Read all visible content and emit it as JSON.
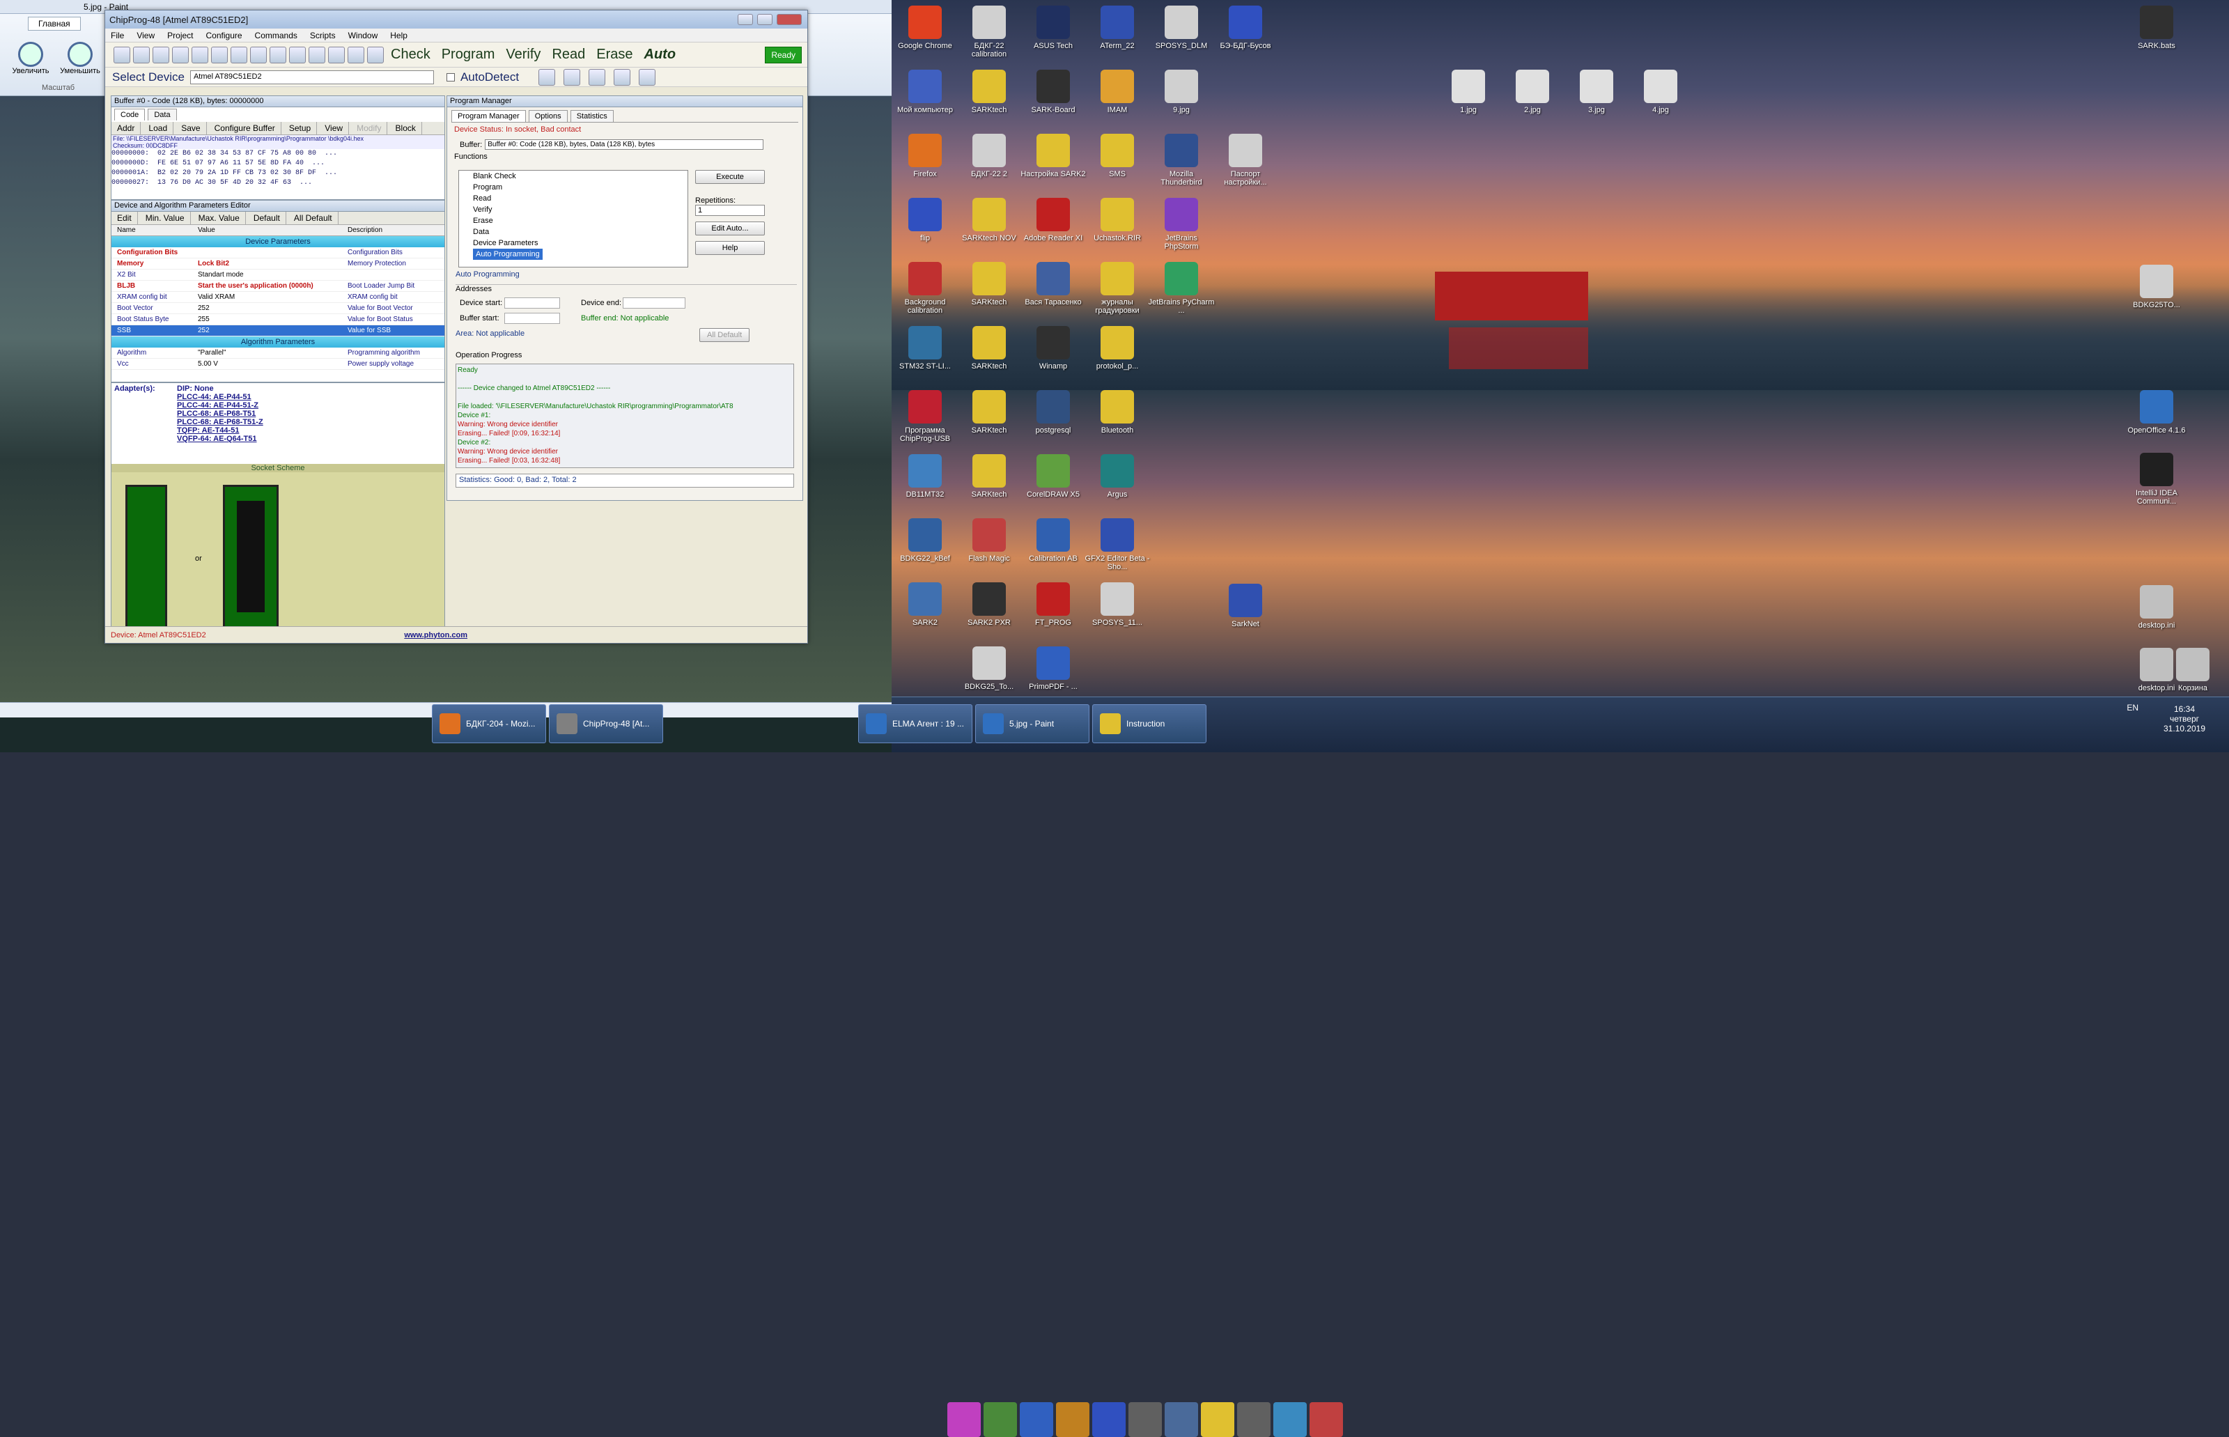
{
  "paint": {
    "title": "5.jpg - Paint",
    "tab_home": "Главная",
    "zoom_in": "Увеличить",
    "zoom_out": "Уменьшить",
    "group": "Масштаб"
  },
  "chipprog": {
    "title": "ChipProg-48 [Atmel AT89C51ED2]",
    "menu": [
      "File",
      "View",
      "Project",
      "Configure",
      "Commands",
      "Scripts",
      "Window",
      "Help"
    ],
    "commands": [
      "Check",
      "Program",
      "Verify",
      "Read",
      "Erase",
      "Auto"
    ],
    "ready": "Ready",
    "select_device": "Select Device",
    "device_combo": "Atmel AT89C51ED2",
    "autodetect": "AutoDetect",
    "buffer": {
      "title": "Buffer #0 - Code (128 KB), bytes: 00000000",
      "tabs": [
        "Code",
        "Data"
      ],
      "toolbar": [
        "Addr",
        "Load",
        "Save",
        "Configure Buffer",
        "Setup",
        "View",
        "Modify",
        "Block"
      ],
      "file": "File: \\\\FILESERVER\\Manufacture\\Uchastok RIR\\programming\\Programmator \\bdkg04i.hex",
      "checksum": "Checksum: 00DC8DFF",
      "rows": [
        "00000000:  02 2E B6 02 38 34 53 87 CF 75 A8 00 80  ...",
        "0000000D:  FE 6E 51 07 97 A6 11 57 5E 8D FA 40  ...",
        "0000001A:  B2 02 20 79 2A 1D FF CB 73 02 30 8F DF  ...",
        "00000027:  13 76 D0 AC 30 5F 4D 20 32 4F 63  ..."
      ]
    },
    "params": {
      "title": "Device and Algorithm Parameters Editor",
      "toolbar": [
        "Edit",
        "Min. Value",
        "Max. Value",
        "Default",
        "All Default"
      ],
      "headers": [
        "Name",
        "Value",
        "Description"
      ],
      "section1": "Device Parameters",
      "rows": [
        {
          "name": "Configuration Bits",
          "value": "",
          "desc": "Configuration Bits",
          "red": true
        },
        {
          "name": "Memory",
          "value": "Lock Bit2",
          "desc": "Memory Protection",
          "red": true
        },
        {
          "name": "X2 Bit",
          "value": "Standart mode",
          "desc": ""
        },
        {
          "name": "BLJB",
          "value": "Start the user's application (0000h)",
          "desc": "Boot Loader Jump Bit",
          "red": true
        },
        {
          "name": "XRAM config bit",
          "value": "Valid XRAM",
          "desc": "XRAM config bit"
        },
        {
          "name": "Boot Vector",
          "value": "252",
          "desc": "Value for Boot Vector"
        },
        {
          "name": "Boot Status Byte",
          "value": "255",
          "desc": "Value for Boot Status"
        },
        {
          "name": "SSB",
          "value": "252",
          "desc": "Value for SSB",
          "selected": true
        }
      ],
      "section2": "Algorithm Parameters",
      "rows2": [
        {
          "name": "Algorithm",
          "value": "\"Parallel\"",
          "desc": "Programming algorithm"
        },
        {
          "name": "Vcc",
          "value": "5.00 V",
          "desc": "Power supply voltage"
        }
      ]
    },
    "adapters": {
      "label": "Adapter(s):",
      "items": [
        "DIP: None",
        "PLCC-44: AE-P44-51",
        "PLCC-44: AE-P44-51-Z",
        "PLCC-68: AE-P68-T51",
        "PLCC-68: AE-P68-T51-Z",
        "TQFP: AE-T44-51",
        "VQFP-64: AE-Q64-T51"
      ],
      "scheme": "Socket Scheme",
      "or": "or"
    },
    "status": "Device: Atmel AT89C51ED2",
    "website": "www.phyton.com",
    "pm": {
      "title": "Program Manager",
      "tabs": [
        "Program Manager",
        "Options",
        "Statistics"
      ],
      "device_status": "Device Status: In socket, Bad contact",
      "buffer_label": "Buffer:",
      "buffer_value": "Buffer #0: Code (128 KB), bytes, Data (128 KB), bytes",
      "functions_label": "Functions",
      "functions": [
        "Blank Check",
        "Program",
        "Read",
        "Verify",
        "Erase",
        "Data",
        "Device Parameters",
        "Auto Programming"
      ],
      "execute": "Execute",
      "repetitions_label": "Repetitions:",
      "repetitions": "1",
      "edit_auto": "Edit Auto...",
      "help": "Help",
      "auto_programming": "Auto Programming",
      "addresses": "Addresses",
      "device_start": "Device start:",
      "device_end": "Device end:",
      "buffer_start": "Buffer start:",
      "buffer_end": "Buffer end:  Not applicable",
      "area": "Area:  Not applicable",
      "all_default": "All Default",
      "op_progress": "Operation Progress",
      "log": [
        {
          "t": "Ready",
          "c": "#0a7a0a"
        },
        {
          "t": "",
          "c": "#000"
        },
        {
          "t": "------ Device changed to Atmel AT89C51ED2 ------",
          "c": "#0a7a0a"
        },
        {
          "t": "",
          "c": "#000"
        },
        {
          "t": "File loaded: '\\\\FILESERVER\\Manufacture\\Uchastok RIR\\programming\\Programmator\\AT8",
          "c": "#0a7a0a"
        },
        {
          "t": "Device #1:",
          "c": "#0a7a0a"
        },
        {
          "t": "Warning: Wrong device identifier",
          "c": "#c01010"
        },
        {
          "t": "Erasing... Failed! [0:09,  16:32:14]",
          "c": "#c01010"
        },
        {
          "t": "Device #2:",
          "c": "#0a7a0a"
        },
        {
          "t": "Warning: Wrong device identifier",
          "c": "#c01010"
        },
        {
          "t": "Erasing... Failed! [0:03,  16:32:48]",
          "c": "#c01010"
        }
      ],
      "stats": "Statistics:  Good: 0,  Bad: 2,  Total: 2"
    }
  },
  "desktop": {
    "icons_col": [
      {
        "label": "Google Chrome",
        "color": "#e04020"
      },
      {
        "label": "Мой компьютер",
        "color": "#4060c0"
      },
      {
        "label": "Firefox",
        "color": "#e07020"
      },
      {
        "label": "flip",
        "color": "#3050c0"
      },
      {
        "label": "Background calibration",
        "color": "#c03030"
      },
      {
        "label": "STM32 ST-LI...",
        "color": "#3070a0"
      },
      {
        "label": "Программа ChipProg-USB",
        "color": "#c02030"
      },
      {
        "label": "DB11MT32",
        "color": "#4080c0"
      },
      {
        "label": "BDKG22_kBef",
        "color": "#3060a0"
      },
      {
        "label": "SARK2",
        "color": "#4070b0"
      }
    ],
    "icons_col2": [
      {
        "label": "БДКГ-22 calibration",
        "color": "#d0d0d0"
      },
      {
        "label": "SARKtech",
        "color": "#e0c030"
      },
      {
        "label": "БДКГ-22 2",
        "color": "#d0d0d0"
      },
      {
        "label": "SARKtech NOV",
        "color": "#e0c030"
      },
      {
        "label": "SARKtech",
        "color": "#e0c030"
      },
      {
        "label": "SARKtech",
        "color": "#e0c030"
      },
      {
        "label": "SARKtech",
        "color": "#e0c030"
      },
      {
        "label": "SARKtech",
        "color": "#e0c030"
      },
      {
        "label": "Flash Magic",
        "color": "#c04040"
      },
      {
        "label": "SARK2 PXR",
        "color": "#303030"
      },
      {
        "label": "BDKG25_To...",
        "color": "#d0d0d0"
      }
    ],
    "icons_col3": [
      {
        "label": "ASUS Tech",
        "color": "#203060"
      },
      {
        "label": "SARK-Board",
        "color": "#303030"
      },
      {
        "label": "Настройка SARK2",
        "color": "#e0c030"
      },
      {
        "label": "Adobe Reader XI",
        "color": "#c02020"
      },
      {
        "label": "Вася Тарасенко",
        "color": "#4060a0"
      },
      {
        "label": "Winamp",
        "color": "#303030"
      },
      {
        "label": "postgresql",
        "color": "#305080"
      },
      {
        "label": "CorelDRAW X5",
        "color": "#60a040"
      },
      {
        "label": "Calibration AB",
        "color": "#3060b0"
      },
      {
        "label": "FT_PROG",
        "color": "#c02020"
      },
      {
        "label": "PrimoPDF - ...",
        "color": "#3060c0"
      }
    ],
    "icons_col4": [
      {
        "label": "ATerm_22",
        "color": "#3050b0"
      },
      {
        "label": "IMAM",
        "color": "#e0a030"
      },
      {
        "label": "SMS",
        "color": "#e0c030"
      },
      {
        "label": "Uchastok.RIR",
        "color": "#e0c030"
      },
      {
        "label": "журналы градуировки",
        "color": "#e0c030"
      },
      {
        "label": "protokol_p...",
        "color": "#e0c030"
      },
      {
        "label": "Bluetooth",
        "color": "#e0c030"
      },
      {
        "label": "Argus",
        "color": "#208080"
      },
      {
        "label": "GFX2 Editor Beta - Sho...",
        "color": "#3050b0"
      },
      {
        "label": "SPOSYS_11...",
        "color": "#d0d0d0"
      }
    ],
    "icons_col5": [
      {
        "label": "SPOSYS_DLM",
        "color": "#d0d0d0"
      },
      {
        "label": "9.jpg",
        "color": "#d0d0d0"
      },
      {
        "label": "Mozilla Thunderbird",
        "color": "#305090"
      },
      {
        "label": "JetBrains PhpStorm",
        "color": "#8040c0"
      },
      {
        "label": "JetBrains PyCharm ...",
        "color": "#30a060"
      }
    ],
    "icons_col6": [
      {
        "label": "БЭ-БДГ-Бусов",
        "color": "#3050c0"
      },
      {
        "label": "Паспорт настройки...",
        "color": "#d0d0d0"
      },
      {
        "label": "SarkNet",
        "color": "#3050b0"
      }
    ],
    "files": [
      "1.jpg",
      "2.jpg",
      "3.jpg",
      "4.jpg"
    ],
    "right_icons": [
      {
        "label": "SARK.bats",
        "color": "#303030"
      },
      {
        "label": "BDKG25TO...",
        "color": "#d0d0d0"
      },
      {
        "label": "OpenOffice 4.1.6",
        "color": "#3070c0"
      },
      {
        "label": "IntelliJ IDEA Communi...",
        "color": "#202020"
      },
      {
        "label": "desktop.ini",
        "color": "#c0c0c0"
      },
      {
        "label": "desktop.ini",
        "color": "#c0c0c0"
      },
      {
        "label": "Корзина",
        "color": "#c0c0c0"
      }
    ]
  },
  "taskbar": {
    "apps": [
      {
        "label": "БДКГ-204 - Mozi...",
        "color": "#e07020"
      },
      {
        "label": "ChipProg-48 [At...",
        "color": "#808080"
      },
      {
        "label": "ELMA Агент : 19 ...",
        "color": "#3070c0"
      },
      {
        "label": "5.jpg - Paint",
        "color": "#3070c0"
      },
      {
        "label": "Instruction",
        "color": "#e0c030"
      }
    ],
    "lang": "EN",
    "time": "16:34",
    "day": "четверг",
    "date": "31.10.2019"
  }
}
